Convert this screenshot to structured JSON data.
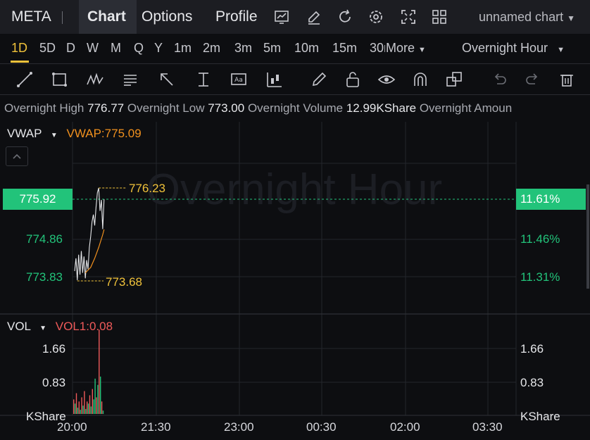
{
  "header": {
    "symbol": "META",
    "tabs": [
      "Chart",
      "Options",
      "Profile"
    ],
    "active_tab": "Chart",
    "chart_name": "unnamed chart",
    "toolbar_icons": [
      "chart-icon",
      "edit-icon",
      "refresh-icon",
      "settings-icon",
      "fullscreen-icon",
      "layout-grid-icon"
    ]
  },
  "resolutions": [
    "1D",
    "5D",
    "D",
    "W",
    "M",
    "Q",
    "Y",
    "1m",
    "2m",
    "3m",
    "5m",
    "10m",
    "15m",
    "30m"
  ],
  "active_resolution": "1D",
  "more_label": "More",
  "session_label": "Overnight Hour",
  "drawing_tools": [
    "line-tool-icon",
    "rectangle-tool-icon",
    "pattern-tool-icon",
    "fibonacci-tool-icon",
    "arrow-tool-icon",
    "measure-tool-icon",
    "text-tool-icon",
    "candle-tool-icon",
    "pencil-icon",
    "unlock-icon",
    "eye-icon",
    "magnet-icon",
    "copy-icon",
    "undo-icon",
    "redo-icon",
    "trash-icon"
  ],
  "stats": {
    "high_label": "Overnight High",
    "high_value": "776.77",
    "low_label": "Overnight Low",
    "low_value": "773.00",
    "volume_label": "Overnight Volume",
    "volume_value": "12.99KShare",
    "amount_label": "Overnight Amoun"
  },
  "main_panel": {
    "indicator": "VWAP",
    "indicator_value": "VWAP:775.09",
    "watermark": "Overnight Hour",
    "current_price": "775.92",
    "current_pct": "11.61%",
    "left_ticks": [
      "774.86",
      "773.83"
    ],
    "right_ticks": [
      "11.46%",
      "11.31%"
    ],
    "high_marker": "776.23",
    "low_marker": "773.68"
  },
  "volume_panel": {
    "indicator": "VOL",
    "indicator_value": "VOL1:0.08",
    "left_ticks": [
      "1.66",
      "0.83",
      "KShare"
    ],
    "right_ticks": [
      "1.66",
      "0.83",
      "KShare"
    ]
  },
  "time_axis": [
    "20:00",
    "21:30",
    "23:00",
    "00:30",
    "02:00",
    "03:30"
  ],
  "chart_data": {
    "type": "line",
    "title": "",
    "price_axis": [
      773.0,
      776.8
    ],
    "price_series": [
      {
        "t": 0,
        "p": 773.95
      },
      {
        "t": 1,
        "p": 774.3
      },
      {
        "t": 2,
        "p": 773.7
      },
      {
        "t": 3,
        "p": 774.4
      },
      {
        "t": 4,
        "p": 773.85
      },
      {
        "t": 5,
        "p": 774.5
      },
      {
        "t": 6,
        "p": 773.9
      },
      {
        "t": 7,
        "p": 774.35
      },
      {
        "t": 8,
        "p": 773.75
      },
      {
        "t": 9,
        "p": 774.25
      },
      {
        "t": 10,
        "p": 774.0
      },
      {
        "t": 11,
        "p": 774.6
      },
      {
        "t": 12,
        "p": 774.9
      },
      {
        "t": 13,
        "p": 775.3
      },
      {
        "t": 14,
        "p": 775.5
      },
      {
        "t": 15,
        "p": 775.2
      },
      {
        "t": 16,
        "p": 775.7
      },
      {
        "t": 17,
        "p": 776.1
      },
      {
        "t": 18,
        "p": 776.23
      },
      {
        "t": 19,
        "p": 775.6
      },
      {
        "t": 20,
        "p": 775.9
      },
      {
        "t": 21,
        "p": 775.1
      },
      {
        "t": 22,
        "p": 775.92
      }
    ],
    "vwap_series": [
      {
        "t": 8,
        "p": 773.9
      },
      {
        "t": 12,
        "p": 774.05
      },
      {
        "t": 15,
        "p": 774.3
      },
      {
        "t": 18,
        "p": 774.6
      },
      {
        "t": 21,
        "p": 774.95
      },
      {
        "t": 22,
        "p": 775.09
      }
    ],
    "volume_axis": [
      0,
      2.0
    ],
    "volume_bars": [
      {
        "v": 0.35,
        "up": false
      },
      {
        "v": 0.25,
        "up": true
      },
      {
        "v": 0.5,
        "up": false
      },
      {
        "v": 0.15,
        "up": true
      },
      {
        "v": 0.3,
        "up": false
      },
      {
        "v": 0.1,
        "up": true
      },
      {
        "v": 0.4,
        "up": false
      },
      {
        "v": 0.2,
        "up": true
      },
      {
        "v": 0.55,
        "up": false
      },
      {
        "v": 0.12,
        "up": true
      },
      {
        "v": 0.3,
        "up": false
      },
      {
        "v": 0.25,
        "up": true
      },
      {
        "v": 0.45,
        "up": false
      },
      {
        "v": 0.18,
        "up": true
      },
      {
        "v": 0.6,
        "up": false
      },
      {
        "v": 0.35,
        "up": true
      },
      {
        "v": 0.85,
        "up": true
      },
      {
        "v": 0.4,
        "up": false
      },
      {
        "v": 0.7,
        "up": true
      },
      {
        "v": 2.03,
        "up": false
      },
      {
        "v": 0.9,
        "up": true
      },
      {
        "v": 0.3,
        "up": false
      },
      {
        "v": 0.08,
        "up": true
      }
    ]
  }
}
